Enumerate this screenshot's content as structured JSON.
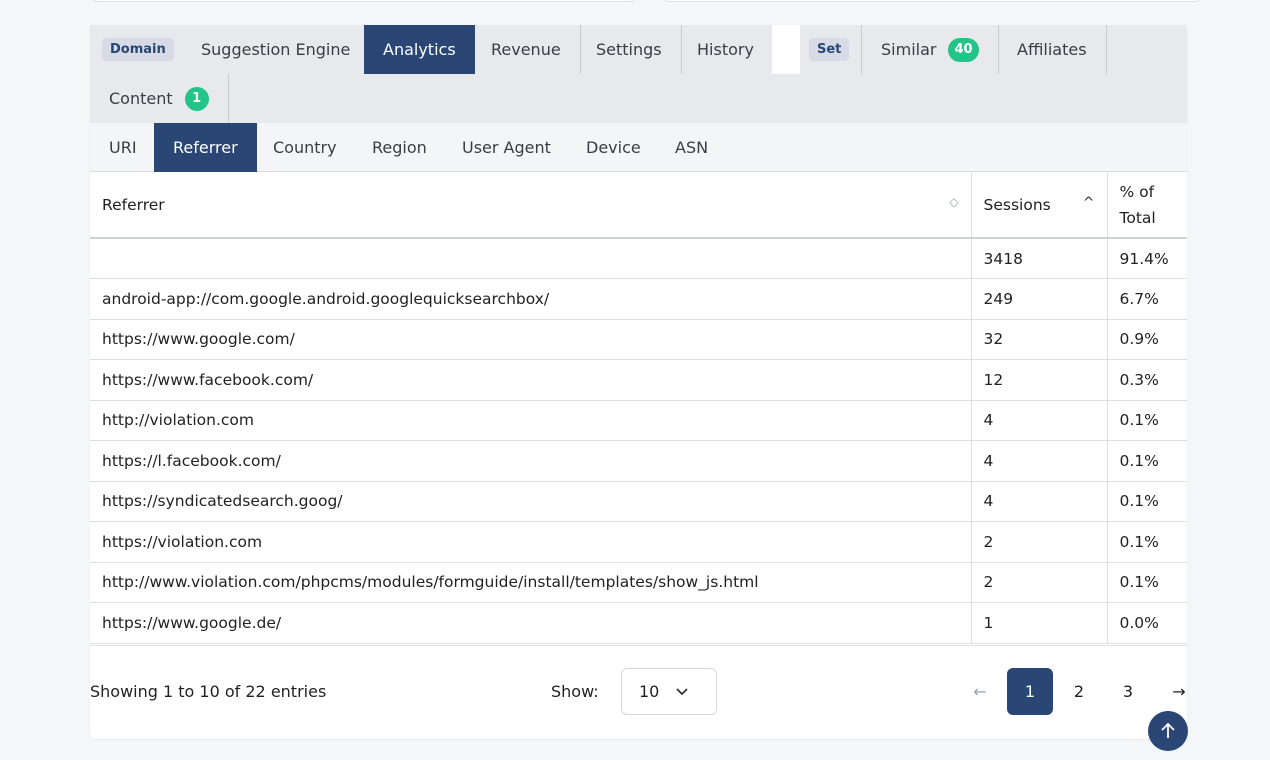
{
  "tabs": {
    "row1": [
      {
        "pill": "Domain"
      },
      {
        "label": "Suggestion Engine"
      },
      {
        "label": "Analytics",
        "active": true
      },
      {
        "label": "Revenue"
      },
      {
        "label": "Settings"
      },
      {
        "label": "History"
      },
      {
        "pill": "Set"
      },
      {
        "label": "Similar",
        "badge": "40"
      },
      {
        "label": "Affiliates"
      }
    ],
    "row2": [
      {
        "label": "Content",
        "badge": "1"
      }
    ]
  },
  "subtabs": [
    "URI",
    "Referrer",
    "Country",
    "Region",
    "User Agent",
    "Device",
    "ASN"
  ],
  "table": {
    "headers": {
      "referrer": "Referrer",
      "sessions": "Sessions",
      "pct_line1": "% of",
      "pct_line2": "Total"
    },
    "rows": [
      {
        "referrer": "",
        "sessions": "3418",
        "pct": "91.4%"
      },
      {
        "referrer": "android-app://com.google.android.googlequicksearchbox/",
        "sessions": "249",
        "pct": "6.7%"
      },
      {
        "referrer": "https://www.google.com/",
        "sessions": "32",
        "pct": "0.9%"
      },
      {
        "referrer": "https://www.facebook.com/",
        "sessions": "12",
        "pct": "0.3%"
      },
      {
        "referrer": "http://violation.com",
        "sessions": "4",
        "pct": "0.1%"
      },
      {
        "referrer": "https://l.facebook.com/",
        "sessions": "4",
        "pct": "0.1%"
      },
      {
        "referrer": "https://syndicatedsearch.goog/",
        "sessions": "4",
        "pct": "0.1%"
      },
      {
        "referrer": "https://violation.com",
        "sessions": "2",
        "pct": "0.1%"
      },
      {
        "referrer": "http://www.violation.com/phpcms/modules/formguide/install/templates/show_js.html",
        "sessions": "2",
        "pct": "0.1%"
      },
      {
        "referrer": "https://www.google.de/",
        "sessions": "1",
        "pct": "0.0%"
      }
    ]
  },
  "footer": {
    "showing": "Showing 1 to 10 of 22 entries",
    "show_label": "Show:",
    "page_size": "10",
    "pages": [
      "1",
      "2",
      "3"
    ],
    "prev": "←",
    "next": "→"
  },
  "colors": {
    "accent": "#2a4675",
    "badge": "#22c487"
  }
}
